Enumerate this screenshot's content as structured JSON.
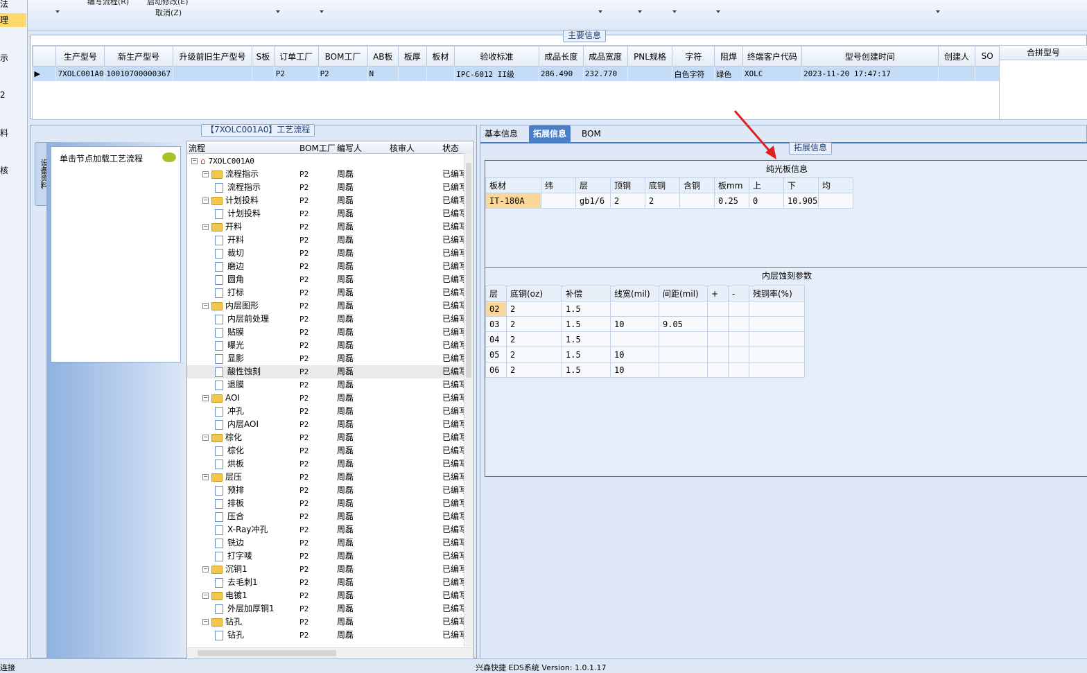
{
  "left_nav": {
    "items": [
      {
        "label": "法",
        "selected": false
      },
      {
        "label": "理",
        "selected": true
      },
      {
        "label": "示",
        "selected": false
      },
      {
        "label": "2",
        "selected": false
      },
      {
        "label": "料",
        "selected": false
      },
      {
        "label": "核",
        "selected": false
      }
    ]
  },
  "ribbon": {
    "edit_flow_label": "编写流程(R)",
    "start_change_label": "启动修改(E)",
    "cancel_label": "取消(Z)"
  },
  "main_info": {
    "group_title": "主要信息",
    "columns": [
      "生产型号",
      "新生产型号",
      "升级前旧生产型号",
      "S板",
      "订单工厂",
      "BOM工厂",
      "AB板",
      "板厚",
      "板材",
      "验收标准",
      "成品长度",
      "成品宽度",
      "PNL规格",
      "字符",
      "阻焊",
      "终端客户代码",
      "型号创建时间",
      "创建人",
      "SO"
    ],
    "rows": [
      [
        "7XOLC001A0",
        "10010700000367",
        "",
        "",
        "P2",
        "P2",
        "N",
        "",
        "",
        "IPC-6012 II级",
        "286.490",
        "232.770",
        "",
        "白色字符",
        "绿色",
        "XOLC",
        "2023-11-20 17:47:17",
        "",
        ""
      ]
    ],
    "side_column": "合拼型号"
  },
  "process_panel": {
    "group_title": "【7XOLC001A0】工艺流程",
    "side_tab_label": "设备资料",
    "hint_text": "单击节点加载工艺流程",
    "columns": [
      "流程",
      "BOM工厂",
      "编写人",
      "核审人",
      "状态"
    ],
    "tree": [
      {
        "name": "7XOLC001A0",
        "level": 0,
        "type": "root",
        "bom": "",
        "writer": "",
        "reviewer": "",
        "status": ""
      },
      {
        "name": "流程指示",
        "level": 1,
        "type": "folder",
        "bom": "P2",
        "writer": "周磊",
        "reviewer": "",
        "status": "已编写"
      },
      {
        "name": "流程指示",
        "level": 2,
        "type": "doc",
        "bom": "P2",
        "writer": "周磊",
        "reviewer": "",
        "status": "已编写"
      },
      {
        "name": "计划投料",
        "level": 1,
        "type": "folder",
        "bom": "P2",
        "writer": "周磊",
        "reviewer": "",
        "status": "已编写"
      },
      {
        "name": "计划投料",
        "level": 2,
        "type": "doc",
        "bom": "P2",
        "writer": "周磊",
        "reviewer": "",
        "status": "已编写"
      },
      {
        "name": "开料",
        "level": 1,
        "type": "folder",
        "bom": "P2",
        "writer": "周磊",
        "reviewer": "",
        "status": "已编写"
      },
      {
        "name": "开料",
        "level": 2,
        "type": "doc",
        "bom": "P2",
        "writer": "周磊",
        "reviewer": "",
        "status": "已编写"
      },
      {
        "name": "裁切",
        "level": 2,
        "type": "doc",
        "bom": "P2",
        "writer": "周磊",
        "reviewer": "",
        "status": "已编写"
      },
      {
        "name": "磨边",
        "level": 2,
        "type": "doc",
        "bom": "P2",
        "writer": "周磊",
        "reviewer": "",
        "status": "已编写"
      },
      {
        "name": "圆角",
        "level": 2,
        "type": "doc",
        "bom": "P2",
        "writer": "周磊",
        "reviewer": "",
        "status": "已编写"
      },
      {
        "name": "打标",
        "level": 2,
        "type": "doc",
        "bom": "P2",
        "writer": "周磊",
        "reviewer": "",
        "status": "已编写"
      },
      {
        "name": "内层图形",
        "level": 1,
        "type": "folder",
        "bom": "P2",
        "writer": "周磊",
        "reviewer": "",
        "status": "已编写"
      },
      {
        "name": "内层前处理",
        "level": 2,
        "type": "doc",
        "bom": "P2",
        "writer": "周磊",
        "reviewer": "",
        "status": "已编写"
      },
      {
        "name": "贴膜",
        "level": 2,
        "type": "doc",
        "bom": "P2",
        "writer": "周磊",
        "reviewer": "",
        "status": "已编写"
      },
      {
        "name": "曝光",
        "level": 2,
        "type": "doc",
        "bom": "P2",
        "writer": "周磊",
        "reviewer": "",
        "status": "已编写"
      },
      {
        "name": "显影",
        "level": 2,
        "type": "doc",
        "bom": "P2",
        "writer": "周磊",
        "reviewer": "",
        "status": "已编写"
      },
      {
        "name": "酸性蚀刻",
        "level": 2,
        "type": "doc",
        "bom": "P2",
        "writer": "周磊",
        "reviewer": "",
        "status": "已编写",
        "selected": true
      },
      {
        "name": "退膜",
        "level": 2,
        "type": "doc",
        "bom": "P2",
        "writer": "周磊",
        "reviewer": "",
        "status": "已编写"
      },
      {
        "name": "AOI",
        "level": 1,
        "type": "folder",
        "bom": "P2",
        "writer": "周磊",
        "reviewer": "",
        "status": "已编写"
      },
      {
        "name": "冲孔",
        "level": 2,
        "type": "doc",
        "bom": "P2",
        "writer": "周磊",
        "reviewer": "",
        "status": "已编写"
      },
      {
        "name": "内层AOI",
        "level": 2,
        "type": "doc",
        "bom": "P2",
        "writer": "周磊",
        "reviewer": "",
        "status": "已编写"
      },
      {
        "name": "棕化",
        "level": 1,
        "type": "folder",
        "bom": "P2",
        "writer": "周磊",
        "reviewer": "",
        "status": "已编写"
      },
      {
        "name": "棕化",
        "level": 2,
        "type": "doc",
        "bom": "P2",
        "writer": "周磊",
        "reviewer": "",
        "status": "已编写"
      },
      {
        "name": "烘板",
        "level": 2,
        "type": "doc",
        "bom": "P2",
        "writer": "周磊",
        "reviewer": "",
        "status": "已编写"
      },
      {
        "name": "层压",
        "level": 1,
        "type": "folder",
        "bom": "P2",
        "writer": "周磊",
        "reviewer": "",
        "status": "已编写"
      },
      {
        "name": "预排",
        "level": 2,
        "type": "doc",
        "bom": "P2",
        "writer": "周磊",
        "reviewer": "",
        "status": "已编写"
      },
      {
        "name": "排板",
        "level": 2,
        "type": "doc",
        "bom": "P2",
        "writer": "周磊",
        "reviewer": "",
        "status": "已编写"
      },
      {
        "name": "压合",
        "level": 2,
        "type": "doc",
        "bom": "P2",
        "writer": "周磊",
        "reviewer": "",
        "status": "已编写"
      },
      {
        "name": "X-Ray冲孔",
        "level": 2,
        "type": "doc",
        "bom": "P2",
        "writer": "周磊",
        "reviewer": "",
        "status": "已编写"
      },
      {
        "name": "铣边",
        "level": 2,
        "type": "doc",
        "bom": "P2",
        "writer": "周磊",
        "reviewer": "",
        "status": "已编写"
      },
      {
        "name": "打字唛",
        "level": 2,
        "type": "doc",
        "bom": "P2",
        "writer": "周磊",
        "reviewer": "",
        "status": "已编写"
      },
      {
        "name": "沉铜1",
        "level": 1,
        "type": "folder",
        "bom": "P2",
        "writer": "周磊",
        "reviewer": "",
        "status": "已编写"
      },
      {
        "name": "去毛刺1",
        "level": 2,
        "type": "doc",
        "bom": "P2",
        "writer": "周磊",
        "reviewer": "",
        "status": "已编写"
      },
      {
        "name": "电镀1",
        "level": 1,
        "type": "folder",
        "bom": "P2",
        "writer": "周磊",
        "reviewer": "",
        "status": "已编写"
      },
      {
        "name": "外层加厚铜1",
        "level": 2,
        "type": "doc",
        "bom": "P2",
        "writer": "周磊",
        "reviewer": "",
        "status": "已编写"
      },
      {
        "name": "钻孔",
        "level": 1,
        "type": "folder",
        "bom": "P2",
        "writer": "周磊",
        "reviewer": "",
        "status": "已编写"
      },
      {
        "name": "钻孔",
        "level": 2,
        "type": "doc",
        "bom": "P2",
        "writer": "周磊",
        "reviewer": "",
        "status": "已编写"
      }
    ]
  },
  "right_panel": {
    "tabs": [
      {
        "label": "基本信息",
        "active": false
      },
      {
        "label": "拓展信息",
        "active": true
      },
      {
        "label": "BOM",
        "active": false
      }
    ],
    "group_title": "拓展信息",
    "plain_board": {
      "title": "纯光板信息",
      "columns": [
        "板材",
        "纬",
        "层",
        "顶铜",
        "底铜",
        "含铜",
        "板mm",
        "上",
        "下",
        "均"
      ],
      "row": [
        "IT-180A",
        "",
        "gb1/6",
        "2",
        "2",
        "",
        "0.25",
        "0",
        "10.905",
        ""
      ]
    },
    "inner_etch": {
      "title": "内层蚀刻参数",
      "columns": [
        "层",
        "底铜(oz)",
        "补偿",
        "线宽(mil)",
        "间距(mil)",
        "+",
        "-",
        "残铜率(%)"
      ],
      "rows": [
        [
          "02",
          "2",
          "1.5",
          "",
          "",
          "",
          "",
          ""
        ],
        [
          "03",
          "2",
          "1.5",
          "10",
          "9.05",
          "",
          "",
          ""
        ],
        [
          "04",
          "2",
          "1.5",
          "",
          "",
          "",
          "",
          ""
        ],
        [
          "05",
          "2",
          "1.5",
          "10",
          "",
          "",
          "",
          ""
        ],
        [
          "06",
          "2",
          "1.5",
          "10",
          "",
          "",
          "",
          ""
        ]
      ]
    }
  },
  "status_bar": {
    "left_text": "连接",
    "center_text": "兴森快捷 EDS系统 Version: 1.0.1.17"
  },
  "colors": {
    "accent_blue": "#4d7fc8",
    "selection": "#c5dcf7",
    "highlight_orange": "#fbd89a",
    "annotation_red": "#e02020"
  }
}
